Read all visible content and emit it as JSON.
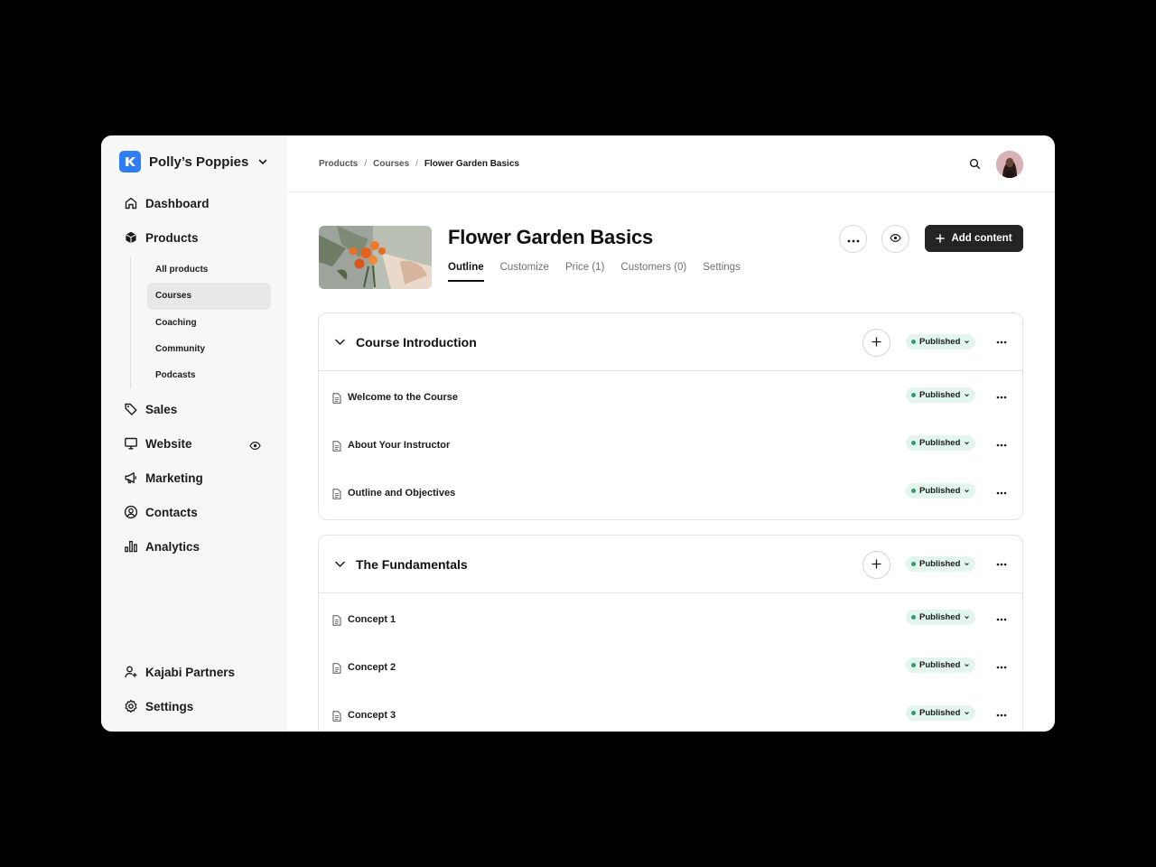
{
  "brand": {
    "name": "Polly’s Poppies"
  },
  "nav": {
    "dashboard": "Dashboard",
    "products": "Products",
    "products_sub": [
      "All products",
      "Courses",
      "Coaching",
      "Community",
      "Podcasts"
    ],
    "sales": "Sales",
    "website": "Website",
    "marketing": "Marketing",
    "contacts": "Contacts",
    "analytics": "Analytics",
    "partners": "Kajabi Partners",
    "settings": "Settings"
  },
  "breadcrumb": [
    "Products",
    "Courses",
    "Flower Garden Basics"
  ],
  "product": {
    "title": "Flower Garden Basics",
    "tabs": [
      "Outline",
      "Customize",
      "Price (1)",
      "Customers (0)",
      "Settings"
    ],
    "add_content_label": "Add content"
  },
  "sections": [
    {
      "title": "Course Introduction",
      "status": "Published",
      "lessons": [
        {
          "title": "Welcome to the Course",
          "status": "Published"
        },
        {
          "title": "About Your Instructor",
          "status": "Published"
        },
        {
          "title": "Outline and Objectives",
          "status": "Published"
        }
      ]
    },
    {
      "title": "The Fundamentals",
      "status": "Published",
      "lessons": [
        {
          "title": "Concept 1",
          "status": "Published"
        },
        {
          "title": "Concept 2",
          "status": "Published"
        },
        {
          "title": "Concept 3",
          "status": "Published"
        }
      ]
    }
  ],
  "colors": {
    "brand": "#2e7cf6",
    "published_bg": "#e3f5ec",
    "published_dot": "#27a06a",
    "primary_button": "#242424"
  },
  "icons": [
    "kajabi-logo-icon",
    "chevron-down-icon",
    "home-icon",
    "box-icon",
    "tag-icon",
    "monitor-icon",
    "eye-icon",
    "megaphone-icon",
    "user-circle-icon",
    "bar-chart-icon",
    "user-plus-icon",
    "gear-icon",
    "search-icon",
    "more-horizontal-icon",
    "plus-icon",
    "document-icon"
  ]
}
